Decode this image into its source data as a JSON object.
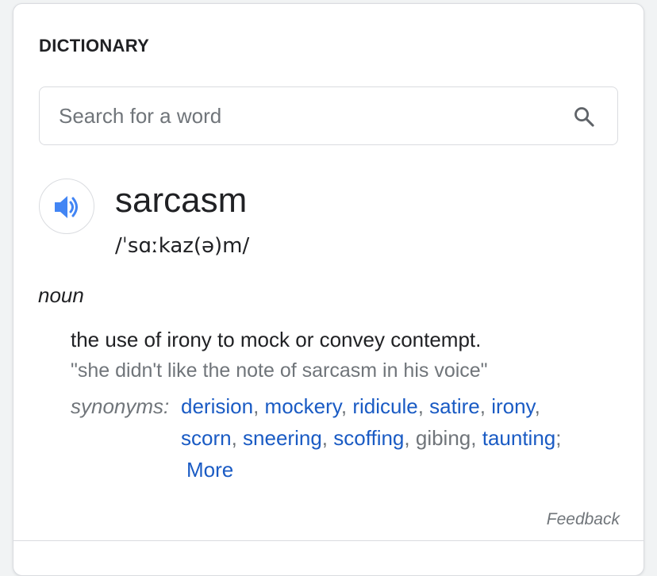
{
  "header": {
    "title": "DICTIONARY"
  },
  "search": {
    "placeholder": "Search for a word",
    "value": ""
  },
  "entry": {
    "word": "sarcasm",
    "phonetic": "/ˈsɑːkaz(ə)m/",
    "part_of_speech": "noun",
    "definition": "the use of irony to mock or convey contempt.",
    "example": "\"she didn't like the note of sarcasm in his voice\"",
    "synonyms_label": "synonyms:",
    "synonyms": [
      {
        "text": "derision",
        "link": true
      },
      {
        "text": "mockery",
        "link": true
      },
      {
        "text": "ridicule",
        "link": true
      },
      {
        "text": "satire",
        "link": true
      },
      {
        "text": "irony",
        "link": true
      },
      {
        "text": "scorn",
        "link": true
      },
      {
        "text": "sneering",
        "link": true
      },
      {
        "text": "scoffing",
        "link": true
      },
      {
        "text": "gibing",
        "link": false
      },
      {
        "text": "taunting",
        "link": true
      }
    ],
    "comma": ",",
    "semicolon": ";",
    "more_label": "More"
  },
  "footer": {
    "feedback_label": "Feedback"
  },
  "icons": {
    "search": "search-icon",
    "speaker": "speaker-icon"
  },
  "colors": {
    "link": "#1a5bc4",
    "muted": "#70757a",
    "text": "#202124",
    "accent": "#4285f4"
  }
}
